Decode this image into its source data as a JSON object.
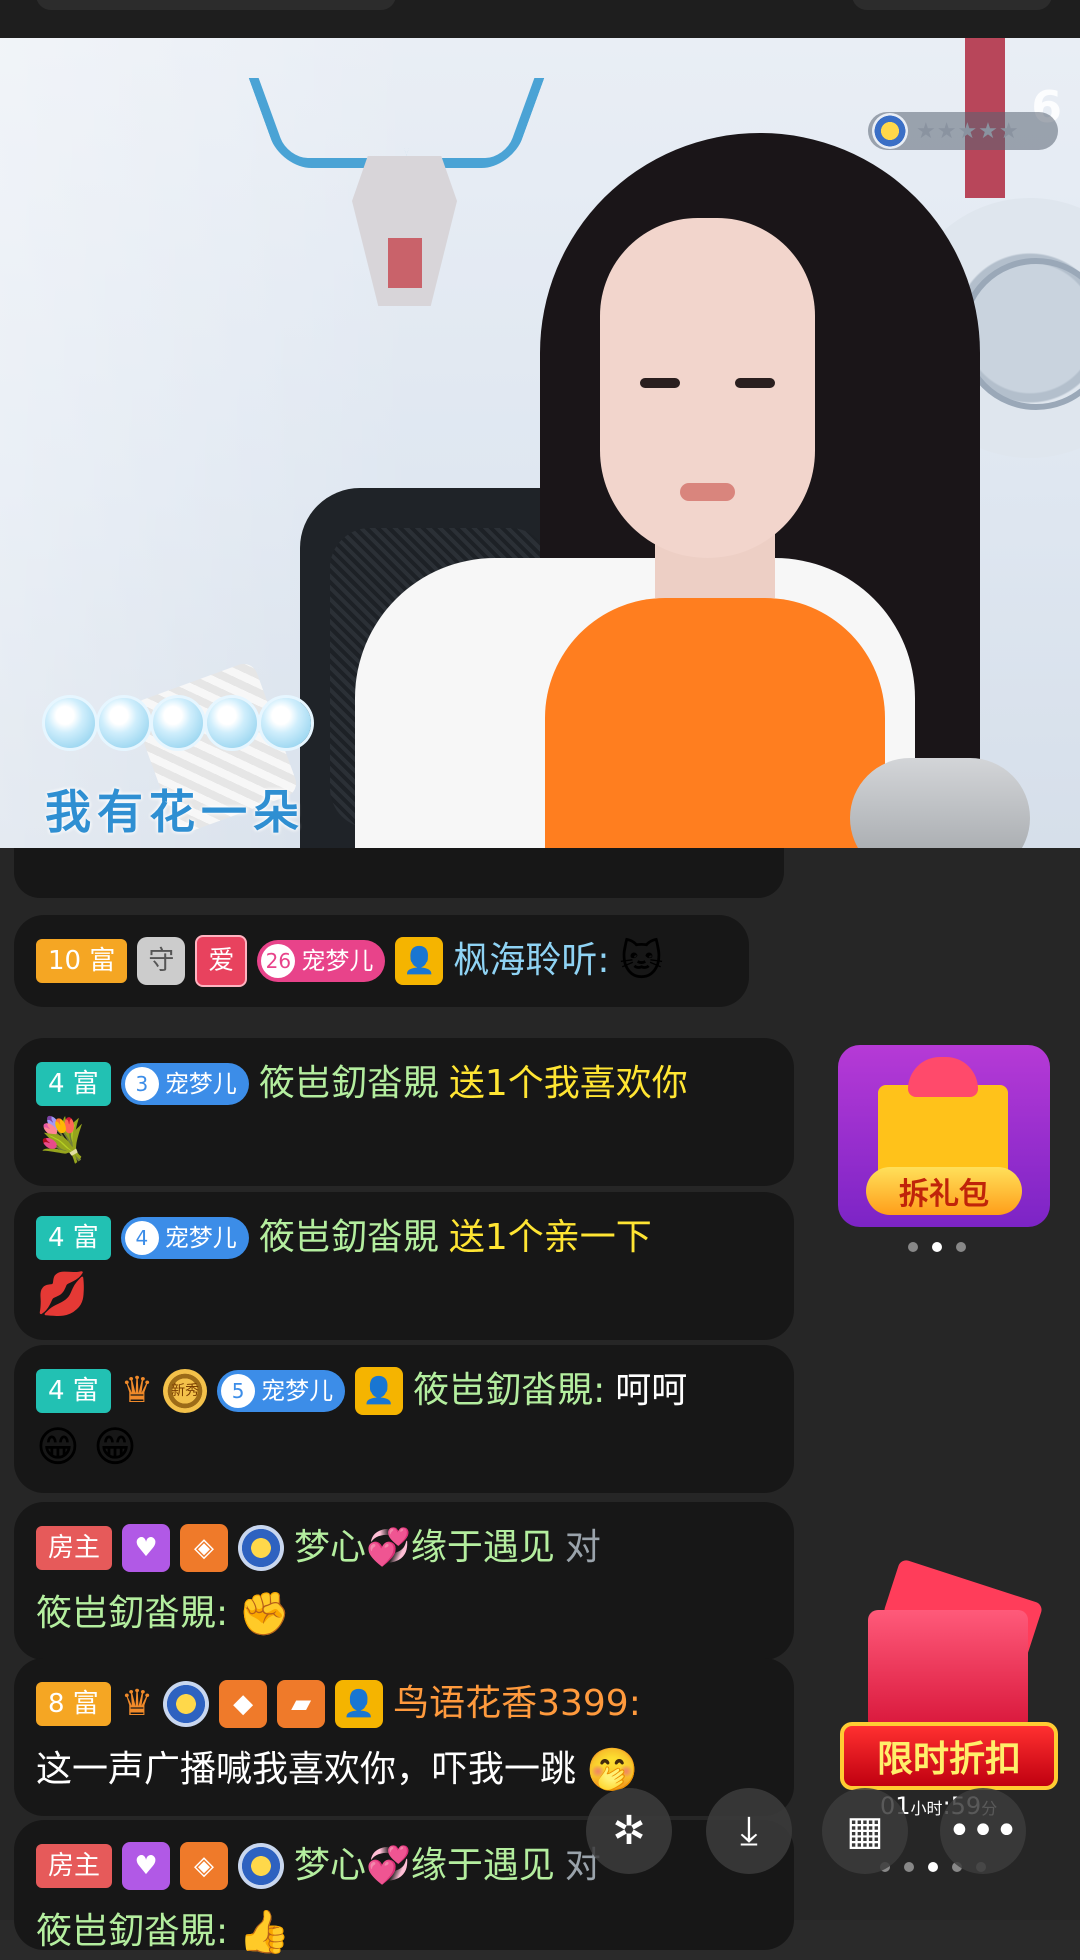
{
  "video": {
    "lyric_text": "我有花一朵",
    "logo_text": "6",
    "rating_stars": "★★★★★"
  },
  "gift_widget": {
    "label": "拆礼包"
  },
  "promo_widget": {
    "label": "限时折扣",
    "timer_hours": "01",
    "timer_hours_unit": "小时",
    "timer_minutes": "59",
    "timer_minutes_unit": "分"
  },
  "chat": [
    {
      "level": "10 富",
      "shield": "守",
      "love": "爱",
      "pet_num": "26",
      "pet": "宠梦儿",
      "user": "枫海聆听:",
      "emoji": "🐱"
    },
    {
      "level": "4 富",
      "pet_num": "3",
      "pet": "宠梦儿",
      "user": "筱岜釖畓覞",
      "gift": "送1个我喜欢你",
      "emoji": "💐"
    },
    {
      "level": "4 富",
      "pet_num": "4",
      "pet": "宠梦儿",
      "user": "筱岜釖畓覞",
      "gift": "送1个亲一下",
      "emoji": "💋"
    },
    {
      "level": "4 富",
      "medal": "新秀",
      "pet_num": "5",
      "pet": "宠梦儿",
      "user": "筱岜釖畓覞:",
      "message": "呵呵",
      "emoji": "😁 😁"
    },
    {
      "level": "房主",
      "user": "梦心💞缘于遇见",
      "to": "对",
      "target": "筱岜釖畓覞:",
      "emoji": "✊"
    },
    {
      "level": "8 富",
      "user": "鸟语花香3399:",
      "message": "这一声广播喊我喜欢你，吓我一跳",
      "emoji": "🤭"
    },
    {
      "level": "房主",
      "user": "梦心💞缘于遇见",
      "to": "对",
      "target": "筱岜釖畓覞:",
      "emoji": "👍"
    }
  ],
  "fab_icons": [
    "sparkle-icon",
    "download-icon",
    "grid-icon",
    "more-icon"
  ]
}
